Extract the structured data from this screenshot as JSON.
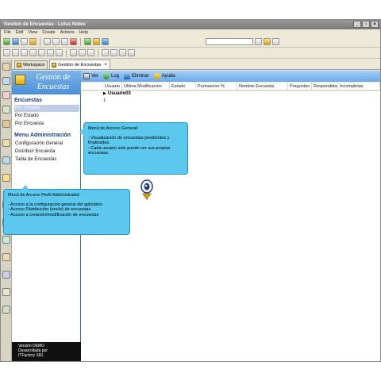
{
  "window": {
    "title": "Gestión de Encuestas - Lotus Notes",
    "controls": [
      "_",
      "▫",
      "×"
    ]
  },
  "menubar": [
    "File",
    "Edit",
    "View",
    "Create",
    "Actions",
    "Help"
  ],
  "tabs": [
    {
      "label": "Workspace"
    },
    {
      "label": "Gestión de Encuestas"
    }
  ],
  "navigator": {
    "title_line1": "Gestión de",
    "title_line2": "Encuestas",
    "sections": [
      {
        "heading": "Encuestas",
        "items": [
          "Por Usuario",
          "Por Estado",
          "Por Encuesta"
        ]
      },
      {
        "heading": "Menu Administración",
        "items": [
          "Configuración General",
          "Distribuir Encuesta",
          "Tabla de Encuestas"
        ]
      }
    ],
    "footer": [
      "Versión DEMO",
      "Desarrollada por",
      "ITFactory SRL"
    ]
  },
  "actionbar": [
    "Ver",
    "Log",
    "Eliminar",
    "Ayuda"
  ],
  "columns": [
    "Usuario",
    "Ultima Modificacion",
    "Estado",
    "Puntuacion %",
    "Nombre Encuesta",
    "Preguntas",
    "Respondidas",
    "Incompletas"
  ],
  "view": {
    "category": "Usuario03",
    "sub": "1"
  },
  "callouts": {
    "general": {
      "title": "Menú de Acceso General:",
      "lines": [
        "- Visualización de encuestas pendientes y",
        "finalizadas.",
        "- Cada usuario solo puede ver sus propias",
        "encuestas"
      ]
    },
    "admin": {
      "title": "Menú de Acceso Perfil Administrador:",
      "lines": [
        "- Acceso a la configuración general del aplicativo",
        "- Acceso Distribución (envío) de encuestas",
        "- Acceso a creación/modificación de encuestas"
      ]
    }
  }
}
